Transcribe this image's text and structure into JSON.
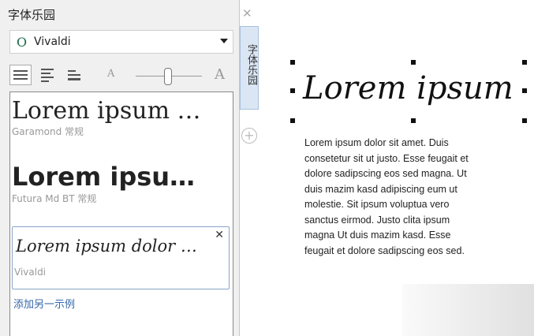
{
  "panel": {
    "title": "字体乐园",
    "close_icon": "close-icon",
    "font_name": "Vivaldi",
    "side_tab": "字体乐园",
    "add_label": "添加另一示例"
  },
  "samples": [
    {
      "text": "Lorem ipsum …",
      "font": "Garamond 常规"
    },
    {
      "text": "Lorem ipsu…",
      "font": "Futura Md BT 常规"
    },
    {
      "text": "Lorem ipsum dolor …",
      "font": "Vivaldi"
    }
  ],
  "canvas": {
    "title": "Lorem ipsum",
    "paragraph": "Lorem ipsum dolor sit amet. Duis consetetur sit ut justo. Esse feugait et dolore sadipscing eos sed magna. Ut duis mazim kasd adipiscing eum ut molestie. Sit ipsum voluptua vero sanctus eirmod. Justo clita ipsum magna Ut duis mazim kasd. Esse feugait et dolore sadipscing eos sed."
  }
}
